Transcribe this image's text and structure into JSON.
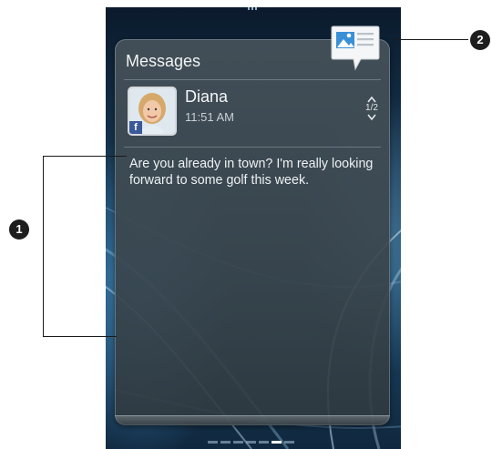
{
  "widget": {
    "title": "Messages",
    "sender": {
      "name": "Diana",
      "time": "11:51 AM",
      "social_badge": "f"
    },
    "pager": {
      "position": "1/2",
      "up_icon": "chevron-up-icon",
      "down_icon": "chevron-down-icon"
    },
    "message": "Are you already in town? I'm really looking forward to some golf this week.",
    "app_icon": "messages-app-icon"
  },
  "home_screen": {
    "page_count": 7,
    "active_page": 6
  },
  "callouts": {
    "message_area": "1",
    "app_icon": "2"
  },
  "colors": {
    "facebook_blue": "#3b5998",
    "card_bg": "#465259",
    "text": "#f2f4f5"
  }
}
